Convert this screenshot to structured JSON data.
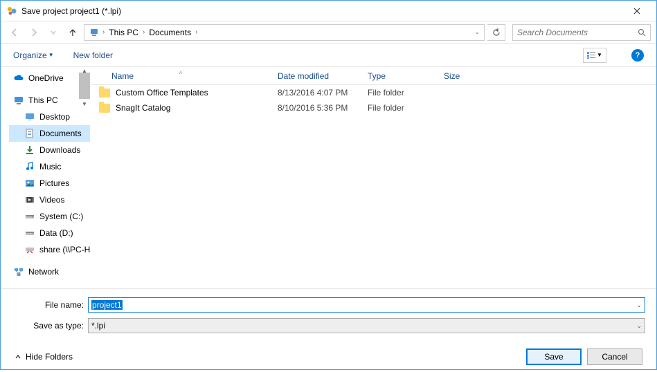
{
  "title": "Save project project1 (*.lpi)",
  "breadcrumb": {
    "root": "This PC",
    "folder": "Documents"
  },
  "search": {
    "placeholder": "Search Documents"
  },
  "toolbar": {
    "organize": "Organize",
    "new_folder": "New folder"
  },
  "sidebar": {
    "items": [
      {
        "label": "OneDrive",
        "icon": "cloud"
      },
      {
        "label": "This PC",
        "icon": "pc"
      },
      {
        "label": "Desktop",
        "icon": "desktop",
        "indent": true
      },
      {
        "label": "Documents",
        "icon": "documents",
        "indent": true,
        "selected": true
      },
      {
        "label": "Downloads",
        "icon": "downloads",
        "indent": true
      },
      {
        "label": "Music",
        "icon": "music",
        "indent": true
      },
      {
        "label": "Pictures",
        "icon": "pictures",
        "indent": true
      },
      {
        "label": "Videos",
        "icon": "videos",
        "indent": true
      },
      {
        "label": "System (C:)",
        "icon": "drive",
        "indent": true
      },
      {
        "label": "Data (D:)",
        "icon": "drive",
        "indent": true
      },
      {
        "label": "share (\\\\PC-H",
        "icon": "netdrive",
        "indent": true
      },
      {
        "label": "Network",
        "icon": "network"
      }
    ]
  },
  "listview": {
    "columns": {
      "name": "Name",
      "date": "Date modified",
      "type": "Type",
      "size": "Size"
    },
    "rows": [
      {
        "name": "Custom Office Templates",
        "date": "8/13/2016 4:07 PM",
        "type": "File folder"
      },
      {
        "name": "SnagIt Catalog",
        "date": "8/10/2016 5:36 PM",
        "type": "File folder"
      }
    ]
  },
  "fields": {
    "filename_label": "File name:",
    "filename_value": "project1",
    "saveastype_label": "Save as type:",
    "saveastype_value": "*.lpi"
  },
  "footer": {
    "hide_folders": "Hide Folders",
    "save": "Save",
    "cancel": "Cancel"
  }
}
